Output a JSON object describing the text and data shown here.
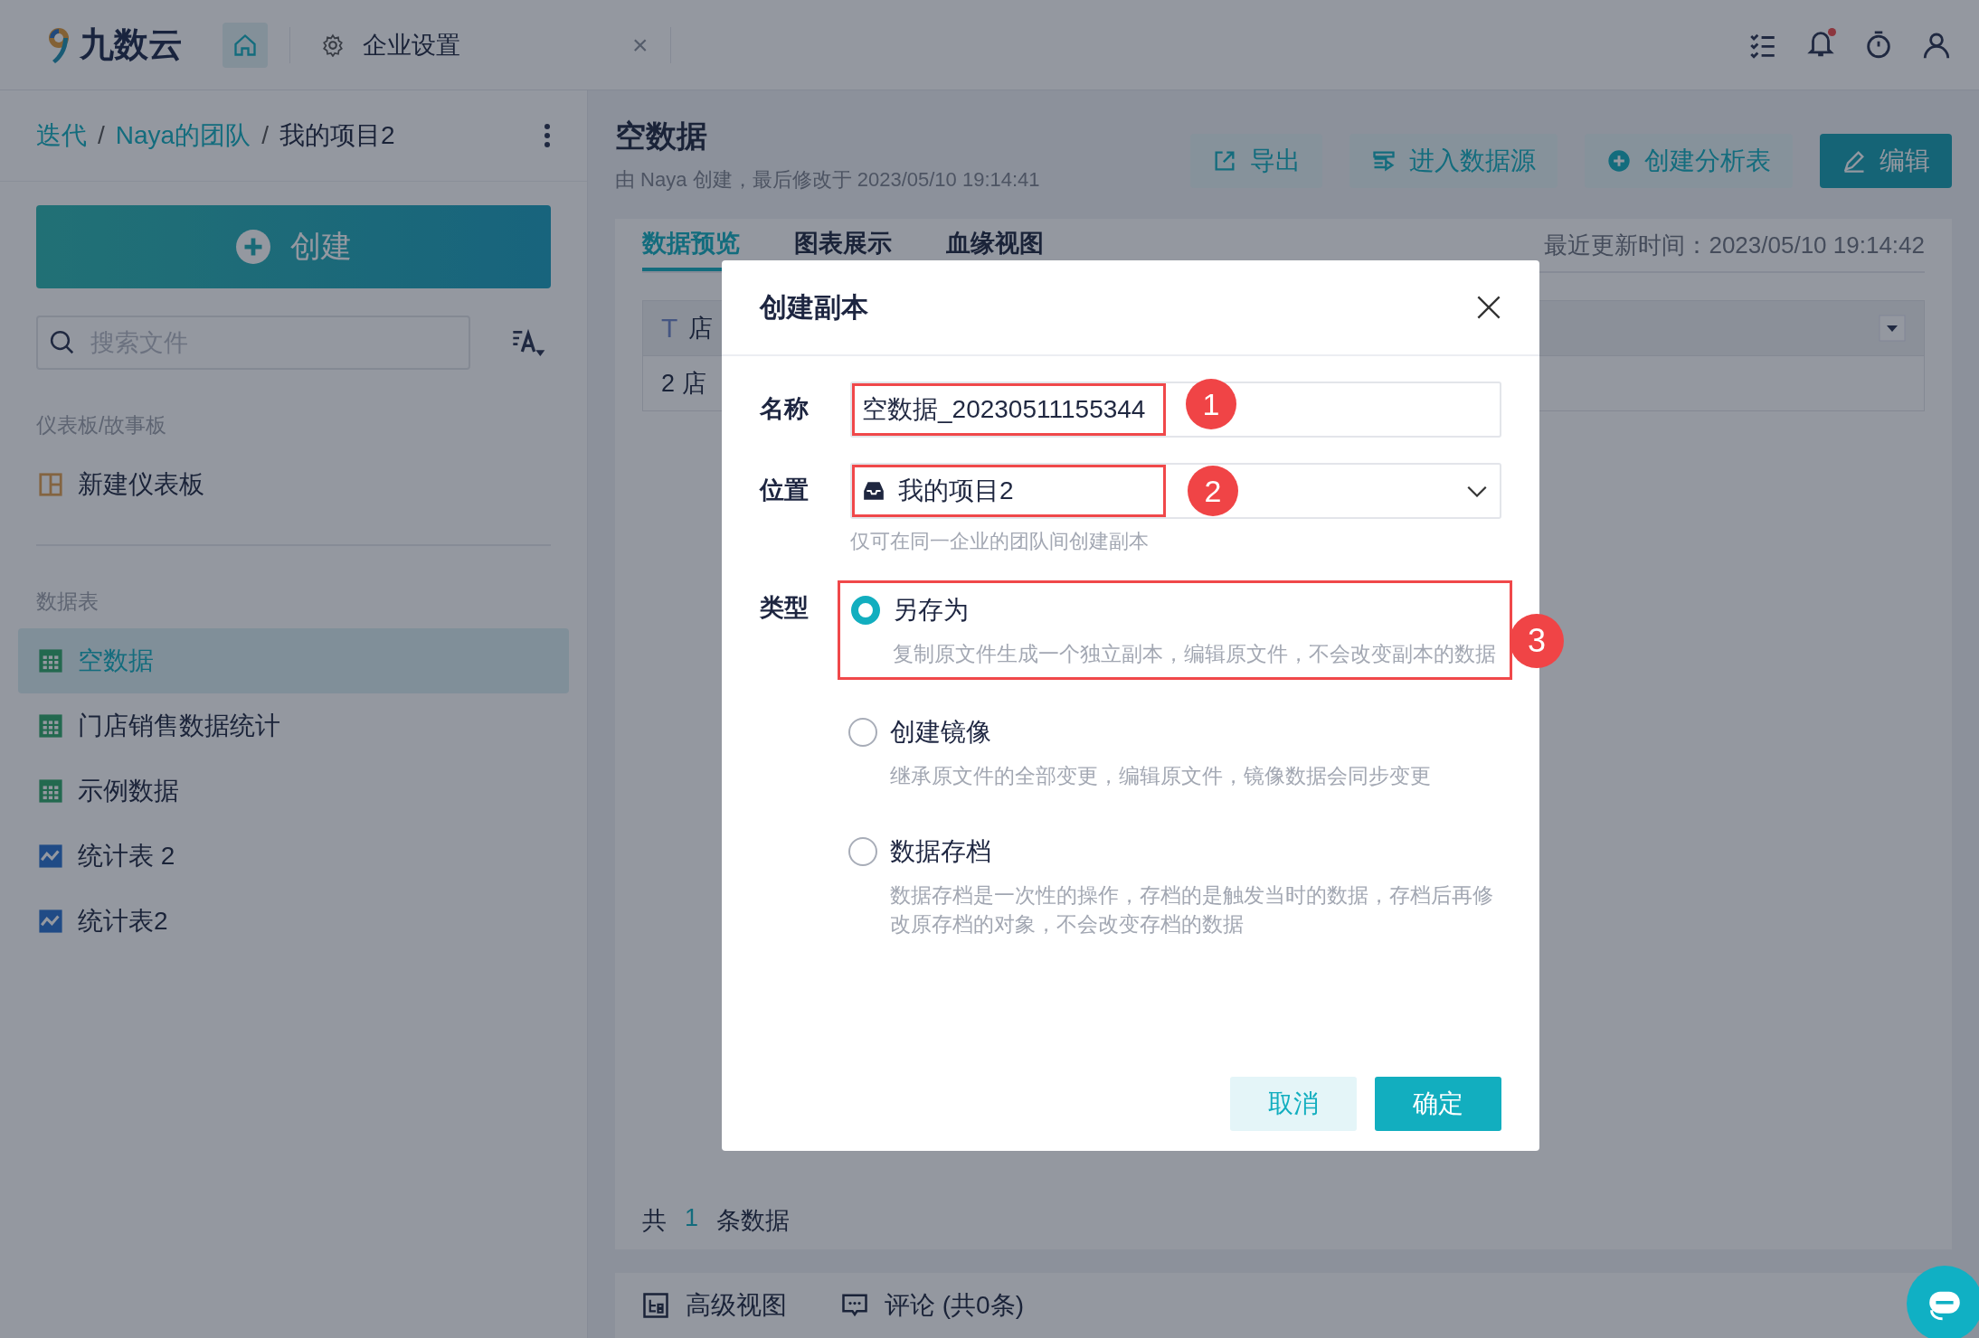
{
  "header": {
    "logo_text": "九数云",
    "tabs": [
      {
        "kind": "home",
        "selected": true
      },
      {
        "kind": "page",
        "label": "企业设置",
        "close": "×",
        "selected": false
      }
    ],
    "has_unread": true
  },
  "sidebar": {
    "breadcrumb": [
      {
        "kind": "link",
        "label": "迭代"
      },
      {
        "kind": "separator",
        "label": "/"
      },
      {
        "kind": "link",
        "label": "Naya的团队"
      },
      {
        "kind": "separator",
        "label": "/"
      },
      {
        "kind": "current",
        "label": "我的项目2"
      }
    ],
    "create_button": "创建",
    "search": {
      "placeholder": "搜索文件"
    },
    "sections": [
      {
        "title": "仪表板/故事板",
        "items": [
          {
            "label": "新建仪表板",
            "kind": "dashboard",
            "selected": false
          }
        ]
      },
      {
        "title": "数据表",
        "items": [
          {
            "label": "空数据",
            "kind": "table",
            "selected": true
          },
          {
            "label": "门店销售数据统计",
            "kind": "table",
            "selected": false
          },
          {
            "label": "示例数据",
            "kind": "table",
            "selected": false
          },
          {
            "label": "统计表 2",
            "kind": "chart",
            "selected": false
          },
          {
            "label": "统计表2",
            "kind": "chart",
            "selected": false
          }
        ]
      }
    ]
  },
  "main": {
    "title": "空数据",
    "subtitle": "由 Naya 创建，最后修改于 2023/05/10 19:14:41",
    "actions": [
      {
        "label": "导出",
        "kind": "export",
        "primary": false
      },
      {
        "label": "进入数据源",
        "kind": "datasource",
        "primary": false
      },
      {
        "label": "创建分析表",
        "kind": "analysis",
        "primary": false
      },
      {
        "label": "编辑",
        "kind": "edit",
        "primary": true
      }
    ],
    "tabs": [
      {
        "label": "数据预览",
        "selected": true
      },
      {
        "label": "图表展示",
        "selected": false
      },
      {
        "label": "血缘视图",
        "selected": false
      }
    ],
    "last_updated": "最近更新时间：2023/05/10 19:14:42",
    "table": {
      "columns": [
        {
          "type_mark": "T",
          "label": "店"
        }
      ],
      "rows": [
        [
          "2 店"
        ]
      ]
    },
    "footer": {
      "prefix": "共",
      "count": "1",
      "suffix": "条数据"
    },
    "bottom_bar": [
      {
        "kind": "view",
        "label": "高级视图"
      },
      {
        "kind": "comment",
        "label": "评论 (共0条)"
      }
    ]
  },
  "dialog": {
    "title": "创建副本",
    "name": {
      "label": "名称",
      "value": "空数据_20230511155344",
      "callout": "1"
    },
    "location": {
      "label": "位置",
      "value": "我的项目2",
      "hint": "仅可在同一企业的团队间创建副本",
      "callout": "2"
    },
    "type": {
      "label": "类型",
      "options": [
        {
          "label": "另存为",
          "description": "复制原文件生成一个独立副本，编辑原文件，不会改变副本的数据",
          "selected": true,
          "callout": "3"
        },
        {
          "label": "创建镜像",
          "description": "继承原文件的全部变更，编辑原文件，镜像数据会同步变更",
          "selected": false
        },
        {
          "label": "数据存档",
          "description": "数据存档是一次性的操作，存档的是触发当时的数据，存档后再修改原存档的对象，不会改变存档的数据",
          "selected": false
        }
      ]
    },
    "buttons": [
      {
        "label": "取消",
        "kind": "secondary"
      },
      {
        "label": "确定",
        "kind": "primary"
      }
    ]
  }
}
